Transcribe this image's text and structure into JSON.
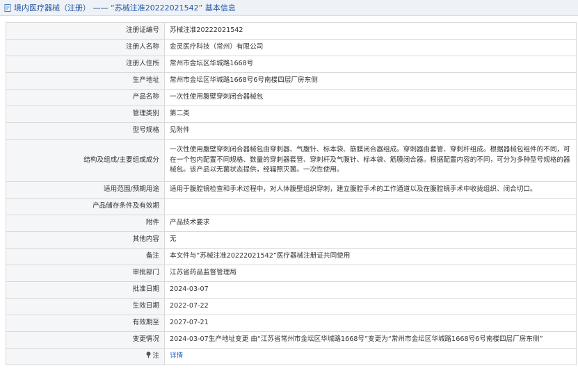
{
  "header": {
    "title": "境内医疗器械（注册） —— “苏械注准20222021542” 基本信息",
    "icon": "document-icon"
  },
  "rows": [
    {
      "label": "注册证编号",
      "value": "苏械注准20222021542"
    },
    {
      "label": "注册人名称",
      "value": "金灵医疗科技（常州）有限公司"
    },
    {
      "label": "注册人住所",
      "value": "常州市金坛区华城路1668号"
    },
    {
      "label": "生产地址",
      "value": "常州市金坛区华城路1668号6号南楼四层厂房东侧"
    },
    {
      "label": "产品名称",
      "value": "一次性使用腹壁穿刺闭合器械包"
    },
    {
      "label": "管理类别",
      "value": "第二类"
    },
    {
      "label": "型号规格",
      "value": "见附件"
    },
    {
      "label": "结构及组成/主要组成成分",
      "value": "一次性使用腹壁穿刺闭合器械包由穿刺器、气腹针、标本袋、筋膜闭合器组成。穿刺器由套管、穿刺杆组成。根据器械包组件的不同，可在一个包内配置不同规格、数量的穿刺器套管、穿刺杆及气腹针、标本袋、筋膜闭合器。根据配置内容的不同，可分为多种型号规格的器械包。该产品以无菌状态提供，经辐照灭菌。一次性使用。"
    },
    {
      "label": "适用范围/预期用途",
      "value": "适用于腹腔镜检查和手术过程中，对人体腹壁组织穿刺，建立腹腔手术的工作通道以及在腹腔镜手术中收拢组织、闭合切口。"
    },
    {
      "label": "产品储存条件及有效期",
      "value": ""
    },
    {
      "label": "附件",
      "value": "产品技术要求"
    },
    {
      "label": "其他内容",
      "value": "无"
    },
    {
      "label": "备注",
      "value": "本文件与“苏械注准20222021542”医疗器械注册证共同使用"
    },
    {
      "label": "审批部门",
      "value": "江苏省药品监督管理局"
    },
    {
      "label": "批准日期",
      "value": "2024-03-07"
    },
    {
      "label": "生效日期",
      "value": "2022-07-22"
    },
    {
      "label": "有效期至",
      "value": "2027-07-21"
    },
    {
      "label": "变更情况",
      "value": "2024-03-07生产地址变更 由“江苏省常州市金坛区华城路1668号”变更为“常州市金坛区华城路1668号6号南楼四层厂房东侧”"
    }
  ],
  "note_row": {
    "label": "注",
    "icon": "pin-icon",
    "link_text": "详情"
  },
  "colors": {
    "title": "#2255a4",
    "link": "#2a62c6",
    "label_bg": "#f5f6f8",
    "border": "#d9d9d9"
  }
}
